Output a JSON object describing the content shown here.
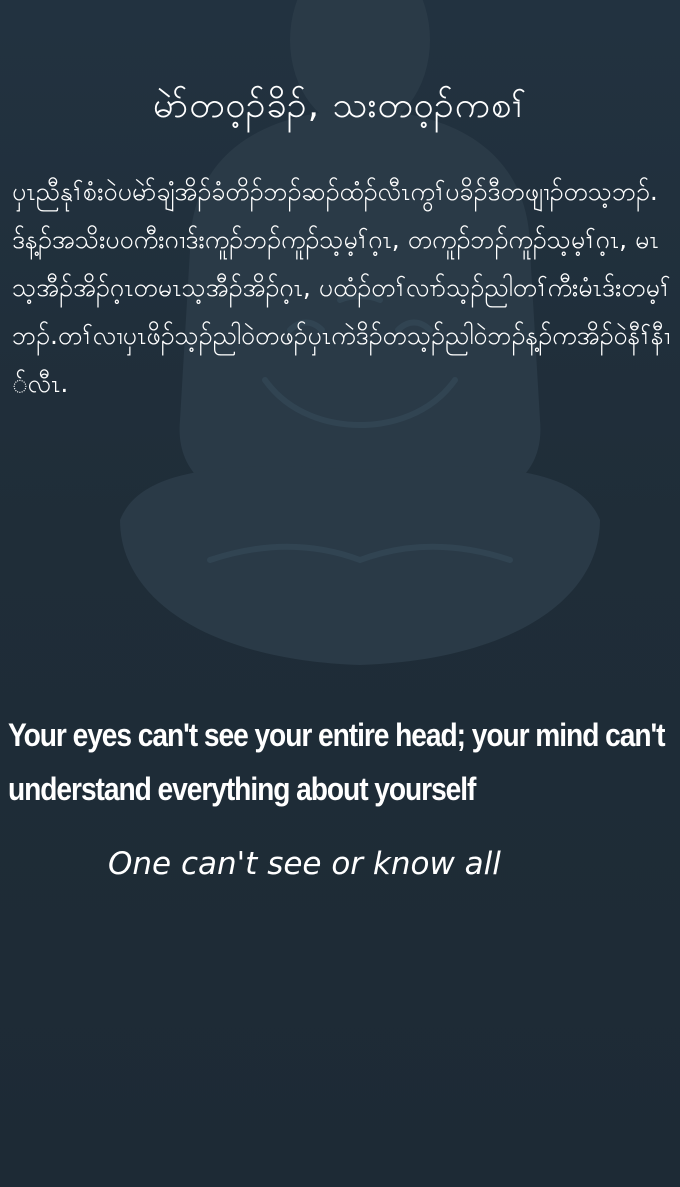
{
  "background_color": "#1e2b36",
  "watermark_icon": "meditating-figure-icon",
  "title": "မဲာ်တဝ့ၣ်ခိၣ်, သးတဝ့ၣ်ကစၢ်",
  "body": "ပှၤညီနုၢ်စံးဝဲပမဲာ်ချံအိၣ်ခံတိၣ်ဘၣ်ဆၣ်ထံၣ်လီၤကွၢ်ပခိၣ်ဒီတဖျၢၣ်တသ့ဘၣ်. ဒ်န့ၣ်အသိးပဝကီးဂၢဒ်းကူၣ်ဘၣ်ကူၣ်သ့မ့ၢ်ဂ့ၤ, တကူၣ်ဘၣ်ကူၣ်သ့မ့ၢ်ဂ့ၤ, မၤသ့အီၣ်အိၣ်ဂ့ၤတမၤသ့အီၣ်အိၣ်ဂ့ၤ, ပထံၣ်တၢ်လၢာ်သ့ၣ်ညါတၢ်ကီးမံၤဒ်းတမ့ၢ်ဘၣ်.တၢ်လၢပှၤဖိၣ်သ့ၣ်ညါဝဲတဖၣ်ပှၤကဲဒိၣ်တသ့ၣ်ညါဝဲဘၣ်န့ၣ်ကအိၣ်ဝဲနီၢ်နီၢ်လီၤ.",
  "english": {
    "line1": "Your eyes can't see your entire head; your mind can't",
    "line2": "understand everything about yourself"
  },
  "tagline": "One can't see or know all"
}
